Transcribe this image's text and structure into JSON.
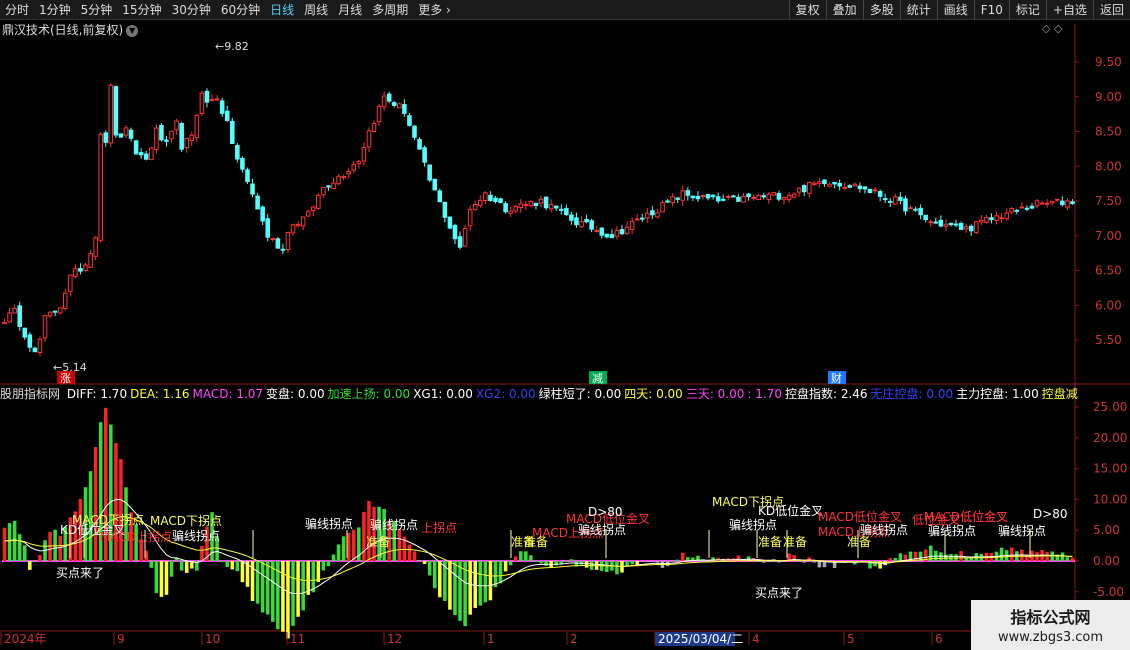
{
  "toolbar": {
    "periods": [
      "分时",
      "1分钟",
      "5分钟",
      "15分钟",
      "30分钟",
      "60分钟",
      "日线",
      "周线",
      "月线",
      "多周期",
      "更多 ›"
    ],
    "active_period": "日线",
    "tools": [
      "复权",
      "叠加",
      "多股",
      "统计",
      "画线",
      "F10",
      "标记",
      "+自选",
      "返回"
    ]
  },
  "stock_title": "鼎汉技术(日线,前复权)",
  "top_icons": "◇ ◇",
  "price_chart": {
    "y_ticks": [
      "9.50",
      "9.00",
      "8.50",
      "8.00",
      "7.50",
      "7.00",
      "6.50",
      "6.00",
      "5.50"
    ],
    "high_label": "9.82",
    "low_label": "5.14",
    "markers": [
      "涨",
      "减",
      "财"
    ]
  },
  "indicator": {
    "name": "股朋指标网",
    "values": [
      {
        "text": "DIFF: 1.70",
        "color": "#ffffff"
      },
      {
        "text": "DEA: 1.16",
        "color": "#ffff33"
      },
      {
        "text": "MACD: 1.07",
        "color": "#ff44ff"
      },
      {
        "text": "变盘: 0.00",
        "color": "#ffffff"
      },
      {
        "text": "加速上扬: 0.00",
        "color": "#33dd33"
      },
      {
        "text": "XG1: 0.00",
        "color": "#ffffff"
      },
      {
        "text": "XG2: 0.00",
        "color": "#3344ff"
      },
      {
        "text": "绿柱短了: 0.00",
        "color": "#ffffff"
      },
      {
        "text": "四天: 0.00",
        "color": "#ffff33"
      },
      {
        "text": "三天: 0.00",
        "color": "#ff44ff"
      },
      {
        "text": ": 1.70",
        "color": "#ff44ff"
      },
      {
        "text": "控盘指数: 2.46",
        "color": "#ffffff"
      },
      {
        "text": "无庄控盘: 0.00",
        "color": "#3344ff"
      },
      {
        "text": "主力控盘: 1.00",
        "color": "#ffffff"
      },
      {
        "text": "控盘减弱: 0",
        "color": "#ffff33"
      }
    ],
    "y_ticks": [
      "25.00",
      "20.00",
      "15.00",
      "10.00",
      "5.00",
      "0.00",
      "-5.00"
    ],
    "labels": [
      "MACD下拐点",
      "MACD下拐点",
      "MACD下拐点",
      "KD低位金叉",
      "KD低位金叉",
      "MACD低位金叉",
      "MACD低位金叉",
      "MACD低位金叉",
      "MACD上拐点",
      "MACD上拐点",
      "MACD上拐点",
      "D>80",
      "D>80",
      "骗线拐点",
      "骗线拐点",
      "骗线拐点",
      "骗线拐点",
      "骗线拐点",
      "骗线拐点",
      "骗线拐点",
      "骗线拐点",
      "准备",
      "准备",
      "准备",
      "准备",
      "准备",
      "准备",
      "买点来了",
      "买点来了",
      "上拐点",
      "低位金叉",
      "低位金叉"
    ]
  },
  "date_axis": {
    "labels": [
      "2024年",
      "9",
      "10",
      "11",
      "12",
      "1",
      "2",
      "2025/03/04/二",
      "4",
      "5",
      "6"
    ]
  },
  "watermark": {
    "line1": "指标公式网",
    "line2": "www.zbgs3.com"
  }
}
